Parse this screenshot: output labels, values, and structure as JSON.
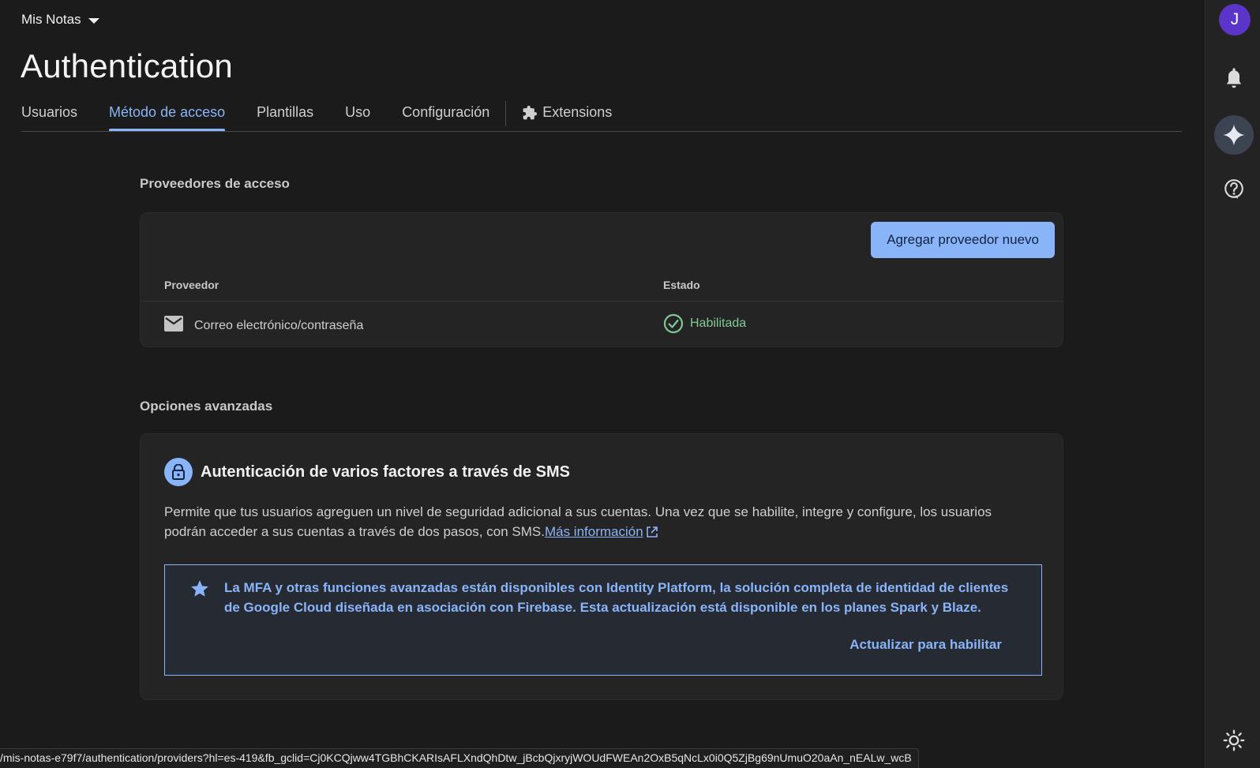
{
  "header": {
    "project_name": "Mis Notas",
    "page_title": "Authentication"
  },
  "tabs": [
    {
      "label": "Usuarios",
      "active": false
    },
    {
      "label": "Método de acceso",
      "active": true
    },
    {
      "label": "Plantillas",
      "active": false
    },
    {
      "label": "Uso",
      "active": false
    },
    {
      "label": "Configuración",
      "active": false
    },
    {
      "label": "Extensions",
      "active": false,
      "icon": "puzzle-icon"
    }
  ],
  "providers_section": {
    "heading": "Proveedores de acceso",
    "add_button": "Agregar proveedor nuevo",
    "columns": {
      "provider": "Proveedor",
      "status": "Estado"
    },
    "rows": [
      {
        "provider": "Correo electrónico/contraseña",
        "provider_icon": "mail-icon",
        "status": "Habilitada",
        "status_icon": "check-circle-icon"
      }
    ]
  },
  "advanced_section": {
    "heading": "Opciones avanzadas",
    "mfa": {
      "title": "Autenticación de varios factores a través de SMS",
      "description": "Permite que tus usuarios agreguen un nivel de seguridad adicional a sus cuentas. Una vez que se habilite, integre y configure, los usuarios podrán acceder a sus cuentas a través de dos pasos, con SMS.",
      "learn_more": "Más información",
      "upsell_message": "La MFA y otras funciones avanzadas están disponibles con Identity Platform, la solución completa de identidad de clientes de Google Cloud diseñada en asociación con Firebase. Esta actualización está disponible en los planes Spark y Blaze.",
      "upgrade_cta": "Actualizar para habilitar"
    }
  },
  "status_bar": {
    "url": "/mis-notas-e79f7/authentication/providers?hl=es-419&fb_gclid=Cj0KCQjww4TGBhCKARIsAFLXndQhDtw_jBcbQjxryjWOUdFWEAn2OxB5qNcLx0i0Q5ZjBg69nUmuO20aAn_nEALw_wcB"
  },
  "rail": {
    "avatar_letter": "J",
    "icons": [
      "bell-icon",
      "gemini-spark-icon",
      "help-icon",
      "theme-sun-icon"
    ]
  },
  "colors": {
    "background": "#1b1b1b",
    "card": "#242424",
    "accent": "#8ab4f8",
    "success": "#81c995",
    "avatar": "#5b35c9"
  }
}
